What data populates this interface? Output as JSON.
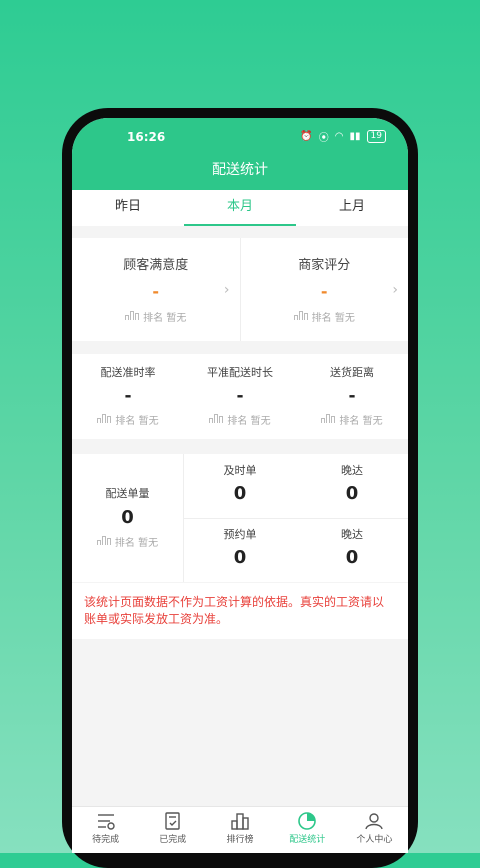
{
  "status": {
    "time": "16:26",
    "battery": "19"
  },
  "header": {
    "title": "配送统计"
  },
  "tabs": [
    {
      "label": "昨日",
      "active": false
    },
    {
      "label": "本月",
      "active": true
    },
    {
      "label": "上月",
      "active": false
    }
  ],
  "ratings": [
    {
      "title": "顾客满意度",
      "value": "-",
      "rank": "排名 暂无"
    },
    {
      "title": "商家评分",
      "value": "-",
      "rank": "排名 暂无"
    }
  ],
  "delivery": [
    {
      "title": "配送准时率",
      "value": "-",
      "rank": "排名 暂无"
    },
    {
      "title": "平准配送时长",
      "value": "-",
      "rank": "排名 暂无"
    },
    {
      "title": "送货距离",
      "value": "-",
      "rank": "排名 暂无"
    }
  ],
  "orders": {
    "main": {
      "title": "配送单量",
      "value": "0",
      "rank": "排名 暂无"
    },
    "cells": [
      {
        "title": "及时单",
        "value": "0"
      },
      {
        "title": "晚达",
        "value": "0"
      },
      {
        "title": "预约单",
        "value": "0"
      },
      {
        "title": "晚达",
        "value": "0"
      }
    ]
  },
  "note": "该统计页面数据不作为工资计算的依据。真实的工资请以账单或实际发放工资为准。",
  "nav": [
    {
      "label": "待完成",
      "icon": "list-icon",
      "active": false
    },
    {
      "label": "已完成",
      "icon": "check-doc-icon",
      "active": false
    },
    {
      "label": "排行榜",
      "icon": "bar-chart-icon",
      "active": false
    },
    {
      "label": "配送统计",
      "icon": "pie-chart-icon",
      "active": true
    },
    {
      "label": "个人中心",
      "icon": "person-icon",
      "active": false
    }
  ],
  "colors": {
    "accent": "#2dc78a",
    "warning": "#f08a2d",
    "note": "#e8413b"
  }
}
